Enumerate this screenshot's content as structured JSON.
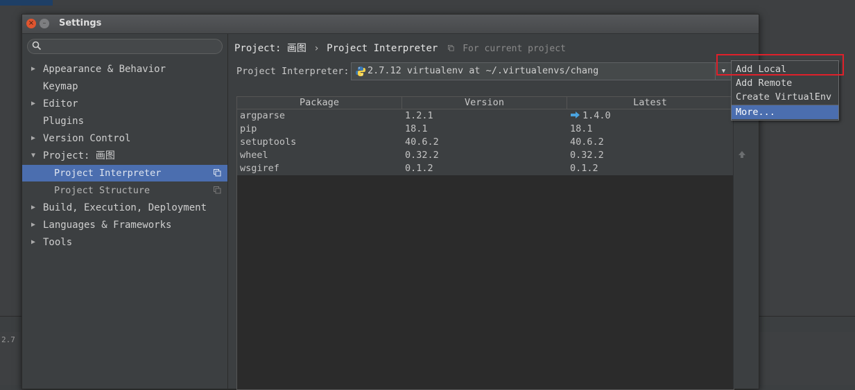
{
  "background": {
    "status_text": "2.7"
  },
  "dialog": {
    "title": "Settings",
    "close_glyph": "×",
    "min_glyph": "–"
  },
  "sidebar": {
    "search_placeholder": "",
    "items": [
      {
        "label": "Appearance & Behavior",
        "arrow": "▶"
      },
      {
        "label": "Keymap"
      },
      {
        "label": "Editor",
        "arrow": "▶"
      },
      {
        "label": "Plugins"
      },
      {
        "label": "Version Control",
        "arrow": "▶"
      },
      {
        "label": "Project: 画图",
        "arrow": "▼"
      },
      {
        "label": "Project Interpreter",
        "selected": true
      },
      {
        "label": "Project Structure"
      },
      {
        "label": "Build, Execution, Deployment",
        "arrow": "▶"
      },
      {
        "label": "Languages & Frameworks",
        "arrow": "▶"
      },
      {
        "label": "Tools",
        "arrow": "▶"
      }
    ]
  },
  "breadcrumb": {
    "project": "Project: 画图",
    "separator": "›",
    "page": "Project Interpreter",
    "scope": "For current project"
  },
  "interpreter": {
    "label": "Project Interpreter:",
    "value": "2.7.12 virtualenv at ~/.virtualenvs/chang",
    "dropdown_glyph": "▼"
  },
  "packages": {
    "columns": [
      "Package",
      "Version",
      "Latest"
    ],
    "rows": [
      {
        "package": "argparse",
        "version": "1.2.1",
        "latest": "1.4.0",
        "upgrade": true
      },
      {
        "package": "pip",
        "version": "18.1",
        "latest": "18.1"
      },
      {
        "package": "setuptools",
        "version": "40.6.2",
        "latest": "40.6.2"
      },
      {
        "package": "wheel",
        "version": "0.32.2",
        "latest": "0.32.2"
      },
      {
        "package": "wsgiref",
        "version": "0.1.2",
        "latest": "0.1.2"
      }
    ]
  },
  "menu": {
    "items": [
      "Add Local",
      "Add Remote",
      "Create VirtualEnv",
      "More..."
    ],
    "active_index": 3
  },
  "colors": {
    "selection": "#4b6eaf",
    "highlight_box": "#e0202a",
    "upgrade_arrow": "#4aa3df"
  }
}
